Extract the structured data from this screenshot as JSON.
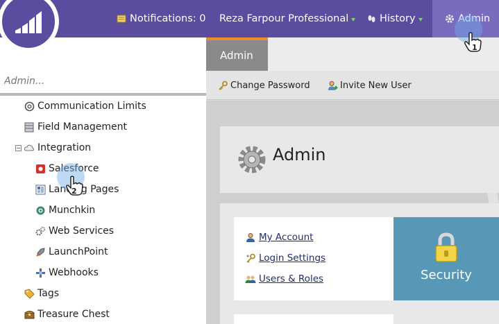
{
  "topbar": {
    "notifications_label": "Notifications: 0",
    "account_label": "Reza Farpour Professional",
    "history_label": "History",
    "admin_label": "Admin"
  },
  "sidebar": {
    "search": {
      "placeholder": "Admin..."
    },
    "items": [
      {
        "label": "Communication Limits"
      },
      {
        "label": "Field Management"
      },
      {
        "label": "Integration"
      },
      {
        "label": "Salesforce"
      },
      {
        "label": "Landing Pages"
      },
      {
        "label": "Munchkin"
      },
      {
        "label": "Web Services"
      },
      {
        "label": "LaunchPoint"
      },
      {
        "label": "Webhooks"
      },
      {
        "label": "Tags"
      },
      {
        "label": "Treasure Chest"
      }
    ]
  },
  "main": {
    "tab_label": "Admin",
    "toolbar": {
      "change_password_label": "Change Password",
      "invite_user_label": "Invite New User"
    },
    "page_title": "Admin",
    "links": [
      {
        "label": "My Account"
      },
      {
        "label": "Login Settings"
      },
      {
        "label": "Users & Roles"
      }
    ],
    "security_tile_label": "Security"
  },
  "annotations": {
    "step_1": "1",
    "step_2": "2"
  },
  "colors": {
    "topbar": "#5c4c9f",
    "active_nav": "#7b6bbe",
    "tab_accent": "#f08a2c",
    "security_tile": "#5798b6"
  }
}
